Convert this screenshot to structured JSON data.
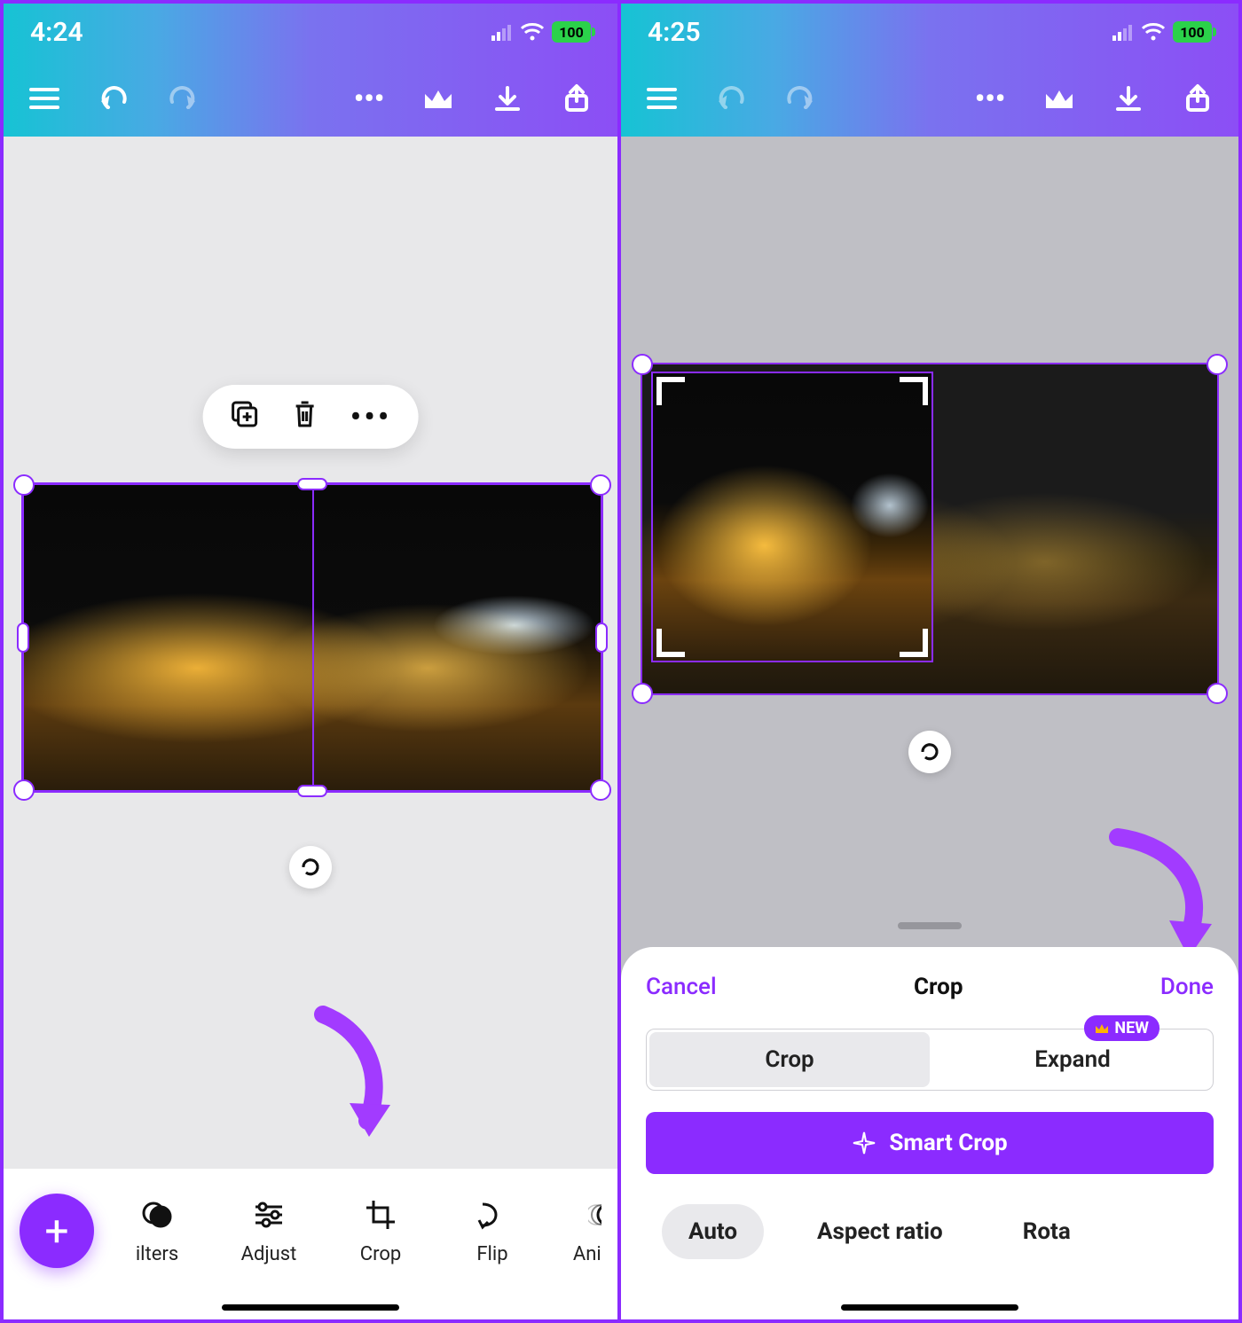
{
  "left": {
    "status": {
      "time": "4:24",
      "battery": "100"
    },
    "context_menu": {
      "copy": "⧉",
      "trash": "🗑",
      "more": "•••"
    },
    "tools": [
      {
        "id": "filters",
        "label": "ilters"
      },
      {
        "id": "adjust",
        "label": "Adjust"
      },
      {
        "id": "crop",
        "label": "Crop"
      },
      {
        "id": "flip",
        "label": "Flip"
      },
      {
        "id": "animate",
        "label": "Animat"
      }
    ],
    "fab": "+"
  },
  "right": {
    "status": {
      "time": "4:25",
      "battery": "100"
    },
    "sheet": {
      "cancel": "Cancel",
      "title": "Crop",
      "done": "Done",
      "seg": {
        "crop": "Crop",
        "expand": "Expand",
        "badge": "NEW"
      },
      "smart": "Smart Crop",
      "tabs": {
        "auto": "Auto",
        "aspect": "Aspect ratio",
        "rotate": "Rota"
      }
    }
  },
  "topbar_icons": {
    "menu": "menu",
    "undo": "undo",
    "redo": "redo",
    "more": "more",
    "crown": "crown",
    "download": "download",
    "share": "share"
  }
}
